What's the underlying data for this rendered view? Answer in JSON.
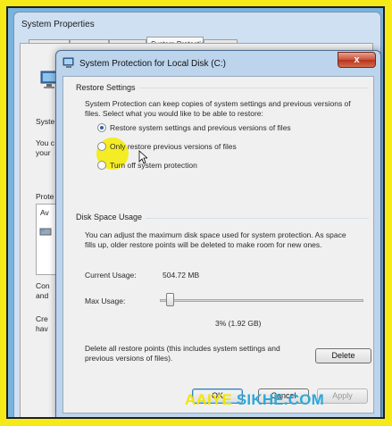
{
  "background_window": {
    "title": "System Properties",
    "tabs": [
      "Computer Name",
      "Hardware",
      "Advanced",
      "System Protection",
      "Remote"
    ],
    "partial_labels": [
      "Syste",
      "You c",
      "your",
      "Prote",
      "Av",
      "Con",
      "and",
      "Cre",
      "hav"
    ]
  },
  "dialog": {
    "title": "System Protection for Local Disk (C:)",
    "close_label": "x",
    "restore_settings": {
      "title": "Restore Settings",
      "description": "System Protection can keep copies of system settings and previous versions of files. Select what you would like to be able to restore:",
      "options": [
        {
          "label": "Restore system settings and previous versions of files",
          "checked": true
        },
        {
          "label": "Only restore previous versions of files",
          "checked": false
        },
        {
          "label": "Turn off system protection",
          "checked": false
        }
      ]
    },
    "disk_space": {
      "title": "Disk Space Usage",
      "description": "You can adjust the maximum disk space used for system protection. As space fills up, older restore points will be deleted to make room for new ones.",
      "current_usage_label": "Current Usage:",
      "current_usage_value": "504.72 MB",
      "max_usage_label": "Max Usage:",
      "max_usage_value": "3% (1.92 GB)",
      "max_usage_fraction": 0.03,
      "delete_text": "Delete all restore points (this includes system settings and previous versions of files).",
      "delete_button": "Delete"
    },
    "buttons": {
      "ok": "OK",
      "cancel": "Cancel",
      "apply": "Apply"
    }
  },
  "watermark": {
    "part1": "AAIYE ",
    "part2": "SIKHE.COM"
  },
  "colors": {
    "frame": "#f5ea18",
    "desktop": "#79b3de",
    "dialog_chrome": "#bcd4ec",
    "close_button": "#c75238"
  }
}
